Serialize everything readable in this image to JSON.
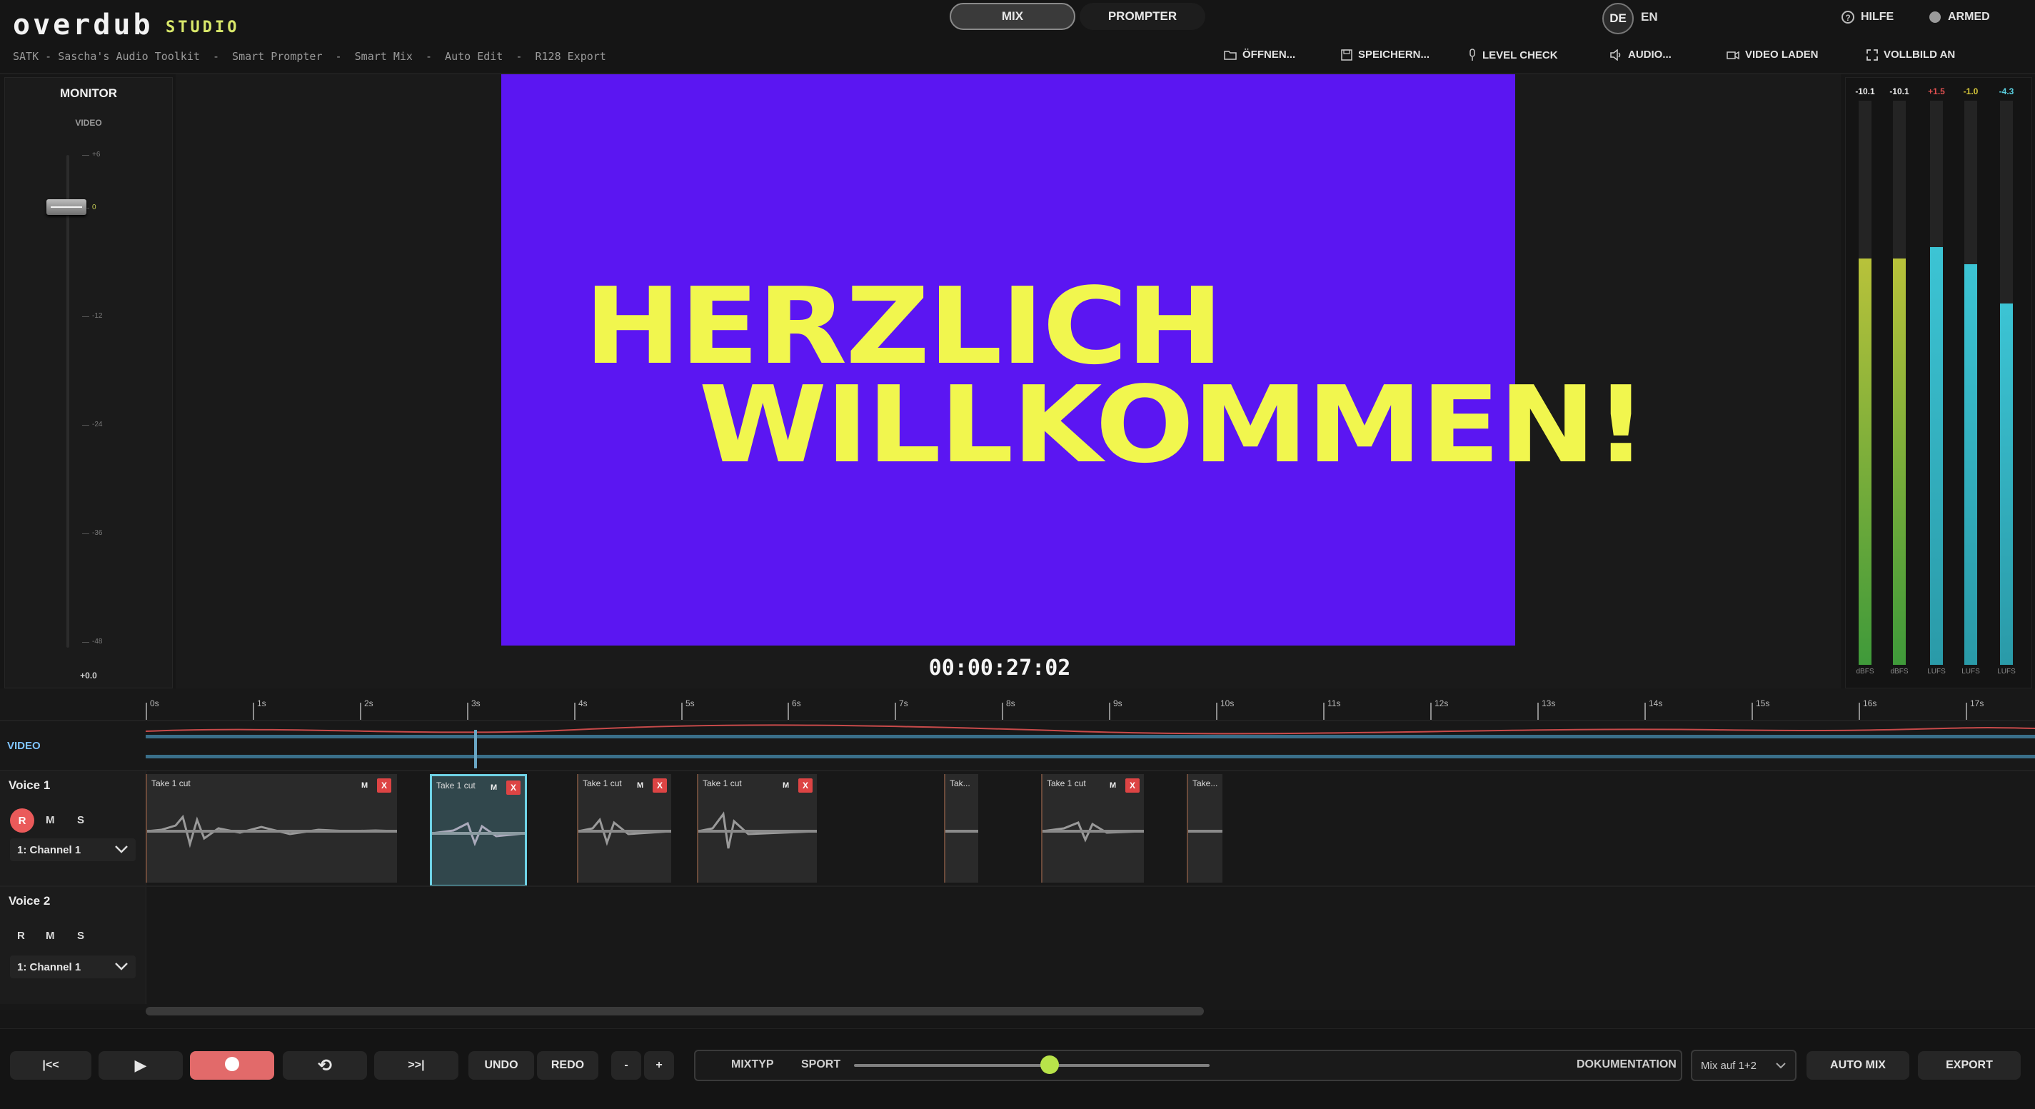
{
  "app": {
    "brand": "overdub",
    "brand_sub": "STUDIO",
    "breadcrumb": "SATK - Sascha's Audio Toolkit  -  Smart Prompter  -  Smart Mix  -  Auto Edit  -  R128 Export"
  },
  "modes": {
    "mix": "MIX",
    "prompter": "PROMPTER"
  },
  "lang": {
    "de": "DE",
    "en": "EN"
  },
  "top": {
    "help": "HILFE",
    "armed": "ARMED"
  },
  "toolbar": {
    "open": "ÖFFNEN...",
    "save": "SPEICHERN...",
    "level_check": "LEVEL CHECK",
    "audio": "AUDIO...",
    "video_load": "VIDEO LADEN",
    "fullscreen": "VOLLBILD AN"
  },
  "monitor": {
    "title": "MONITOR",
    "subtitle": "VIDEO",
    "value": "+0.0",
    "ticks": [
      "+6",
      "0",
      "-12",
      "-24",
      "-36",
      "-48"
    ]
  },
  "preview": {
    "line1": "HERZLICH",
    "line2": "WILLKOMMEN!",
    "timecode": "00:00:27:02",
    "bg_color": "#5b16f2",
    "text_color": "#f1f64e"
  },
  "meters": {
    "top": [
      "-10.1",
      "-10.1",
      "+1.5",
      "-1.0",
      "-4.3"
    ],
    "bottom": [
      "dBFS",
      "dBFS",
      "LUFS",
      "LUFS",
      "LUFS"
    ],
    "levels": [
      0.72,
      0.72,
      0.74,
      0.71,
      0.64
    ],
    "colors": [
      "#b8c23a",
      "#b8c23a",
      "#3cc4d4",
      "#3cc4d4",
      "#3cc4d4"
    ]
  },
  "timeline": {
    "ruler": [
      "0s",
      "1s",
      "2s",
      "3s",
      "4s",
      "5s",
      "6s",
      "7s",
      "8s",
      "9s",
      "10s",
      "11s",
      "12s",
      "13s",
      "14s",
      "15s",
      "16s",
      "17s"
    ],
    "video_label": "VIDEO",
    "tracks": [
      {
        "name": "Voice 1",
        "r": "R",
        "m": "M",
        "s": "S",
        "channel": "1: Channel 1"
      },
      {
        "name": "Voice 2",
        "r": "R",
        "m": "M",
        "s": "S",
        "channel": "1: Channel 1"
      }
    ],
    "clips": [
      {
        "title": "Take 1 cut",
        "m": "M",
        "x": "X"
      },
      {
        "title": "Take 1 cut",
        "m": "M",
        "x": "X"
      },
      {
        "title": "Take 1 cut",
        "m": "M",
        "x": "X"
      },
      {
        "title": "Take 1 cut",
        "m": "M",
        "x": "X"
      },
      {
        "title": "Tak..."
      },
      {
        "title": "Take 1 cut",
        "m": "M",
        "x": "X"
      },
      {
        "title": "Take..."
      }
    ]
  },
  "transport": {
    "to_start": "|<<",
    "play": "▶",
    "loop": "⟲",
    "to_end": ">>|",
    "undo": "UNDO",
    "redo": "REDO",
    "minus": "-",
    "plus": "+",
    "mixtyp": "MIXTYP",
    "sport": "SPORT",
    "slider_value": 0.55,
    "doku": "DOKUMENTATION",
    "mix_select": "Mix auf 1+2",
    "auto_mix": "AUTO MIX",
    "export": "EXPORT"
  }
}
